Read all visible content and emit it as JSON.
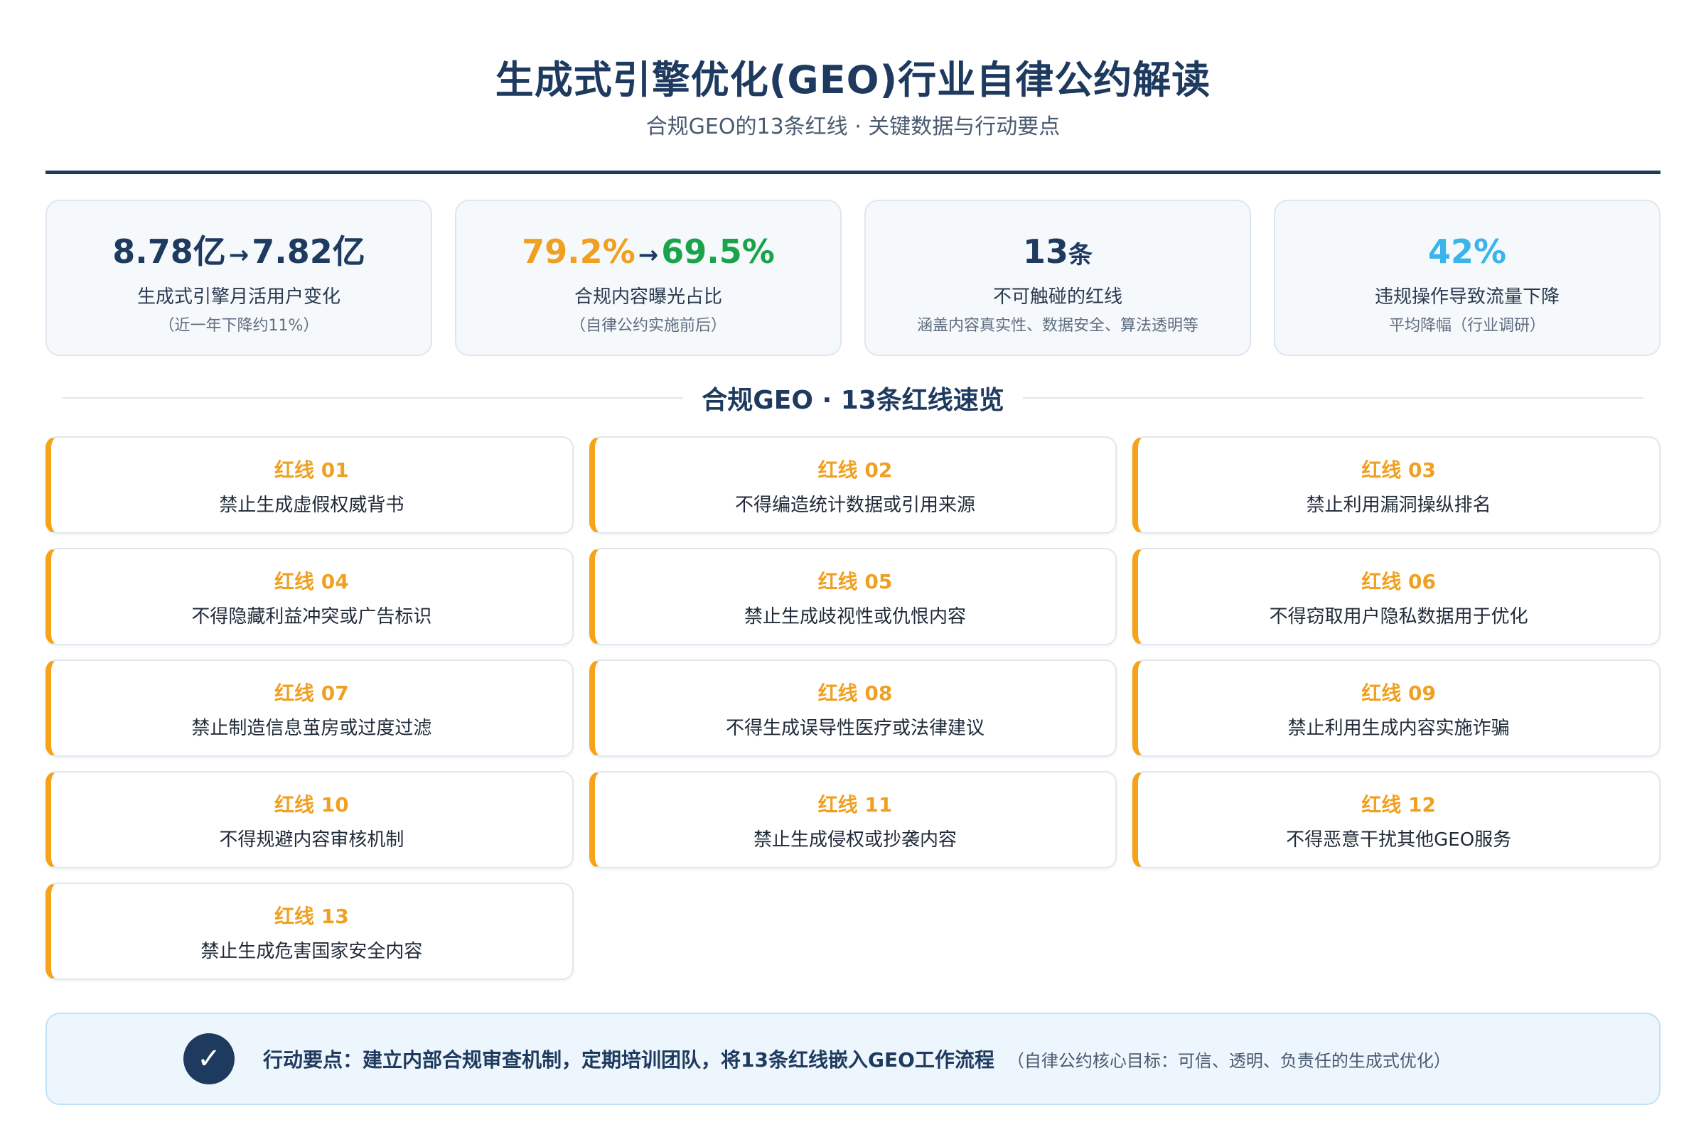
{
  "header": {
    "title": "生成式引擎优化(GEO)行业自律公约解读",
    "subtitle": "合规GEO的13条红线 · 关键数据与行动要点"
  },
  "stats": [
    {
      "from": "8.78亿",
      "to": "7.82亿",
      "label": "生成式引擎月活用户变化",
      "note": "（近一年下降约11%）"
    },
    {
      "from": "79.2%",
      "to": "69.5%",
      "label": "合规内容曝光占比",
      "note": "（自律公约实施前后）"
    },
    {
      "value": "13",
      "unit": "条",
      "label": "不可触碰的红线",
      "note": "涵盖内容真实性、数据安全、算法透明等"
    },
    {
      "value": "42%",
      "label": "违规操作导致流量下降",
      "note": "平均降幅（行业调研）"
    }
  ],
  "arrow_symbol": "→",
  "section": {
    "title": "合规GEO · 13条红线速览"
  },
  "redlines": [
    {
      "num": "红线 01",
      "text": "禁止生成虚假权威背书"
    },
    {
      "num": "红线 02",
      "text": "不得编造统计数据或引用来源"
    },
    {
      "num": "红线 03",
      "text": "禁止利用漏洞操纵排名"
    },
    {
      "num": "红线 04",
      "text": "不得隐藏利益冲突或广告标识"
    },
    {
      "num": "红线 05",
      "text": "禁止生成歧视性或仇恨内容"
    },
    {
      "num": "红线 06",
      "text": "不得窃取用户隐私数据用于优化"
    },
    {
      "num": "红线 07",
      "text": "禁止制造信息茧房或过度过滤"
    },
    {
      "num": "红线 08",
      "text": "不得生成误导性医疗或法律建议"
    },
    {
      "num": "红线 09",
      "text": "禁止利用生成内容实施诈骗"
    },
    {
      "num": "红线 10",
      "text": "不得规避内容审核机制"
    },
    {
      "num": "红线 11",
      "text": "禁止生成侵权或抄袭内容"
    },
    {
      "num": "红线 12",
      "text": "不得恶意干扰其他GEO服务"
    },
    {
      "num": "红线 13",
      "text": "禁止生成危害国家安全内容"
    }
  ],
  "action": {
    "check_symbol": "✓",
    "main": "行动要点：建立内部合规审查机制，定期培训团队，将13条红线嵌入GEO工作流程",
    "note": "（自律公约核心目标：可信、透明、负责任的生成式优化）"
  },
  "colors": {
    "navy": "#1e3a5f",
    "orange": "#f0a020",
    "green": "#1aa34a",
    "blue": "#3bb4ea"
  }
}
